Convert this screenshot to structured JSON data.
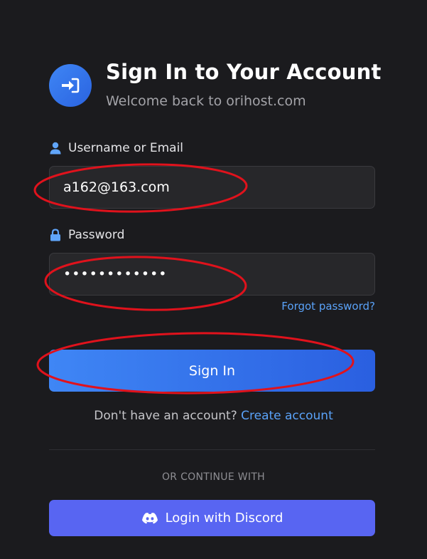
{
  "header": {
    "title": "Sign In to Your Account",
    "subtitle": "Welcome back to orihost.com"
  },
  "form": {
    "username_label": "Username or Email",
    "username_value": "a162@163.com",
    "password_label": "Password",
    "password_value": "••••••••••••",
    "forgot_label": "Forgot password?",
    "submit_label": "Sign In"
  },
  "register": {
    "prompt": "Don't have an account?",
    "link_label": "Create account"
  },
  "alt": {
    "divider_text": "OR CONTINUE WITH",
    "discord_label": "Login with Discord"
  },
  "colors": {
    "accent": "#3f86f5",
    "link": "#5aa2f8",
    "discord": "#5865f2",
    "annotation": "#e0121c"
  },
  "icons": {
    "header": "sign-in-icon",
    "username": "user-icon",
    "password": "lock-icon",
    "discord": "discord-icon"
  }
}
